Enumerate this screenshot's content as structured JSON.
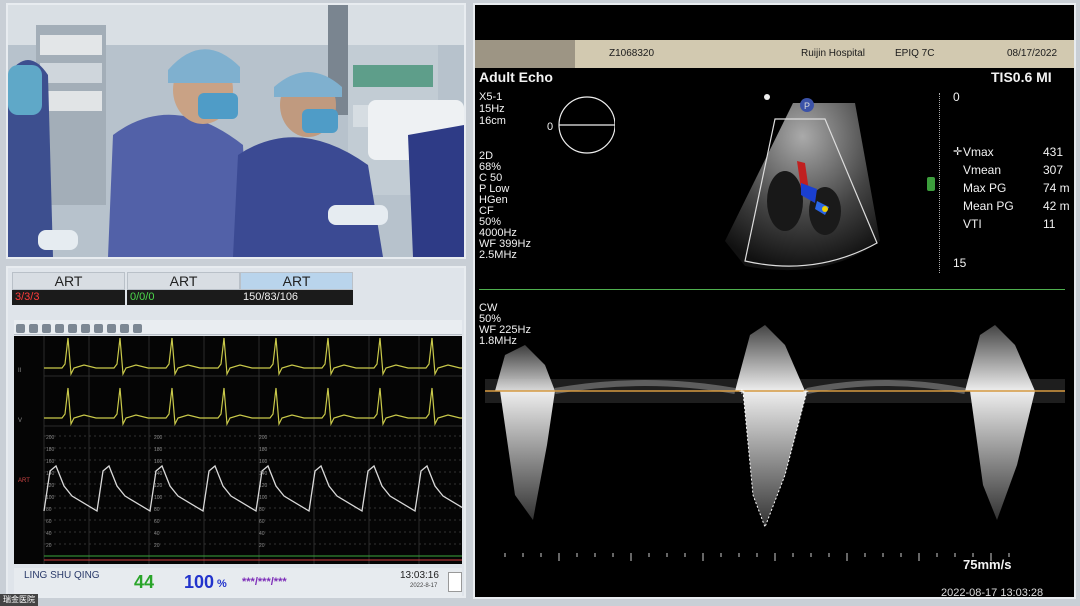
{
  "monitor": {
    "channels": [
      {
        "label": "ART",
        "value": "3/3/3",
        "color": "#ff3b3b"
      },
      {
        "label": "ART",
        "value": "0/0/0",
        "color": "#4cdc4c"
      },
      {
        "label": "ART",
        "value": "150/83/106",
        "color": "#f0f0f0"
      }
    ],
    "patient_name": "LING SHU QING",
    "heart_rate": "44",
    "spo2": "100",
    "spo2_unit": "%",
    "nibp": "***/***/***",
    "time": "13:03:16",
    "date": "2022-8-17",
    "scale_labels": [
      "200",
      "180",
      "160",
      "140",
      "120",
      "100",
      "80",
      "60",
      "40",
      "20"
    ]
  },
  "echo": {
    "patient_id": "Z1068320",
    "hospital": "Ruijin Hospital",
    "device": "EPIQ 7C",
    "date": "08/17/2022",
    "mode": "Adult Echo",
    "index": "TIS0.6 MI",
    "probe_settings": [
      "X5-1",
      "15Hz",
      "16cm"
    ],
    "image_settings": [
      "2D",
      "68%",
      "C 50",
      "P Low",
      "HGen"
    ],
    "color_settings": [
      "CF",
      "50%",
      "4000Hz",
      "WF 399Hz",
      "2.5MHz"
    ],
    "cw_settings": [
      "CW",
      "50%",
      "WF 225Hz",
      "1.8MHz"
    ],
    "depth_start": "0",
    "depth_end": "15",
    "doppler_start": "0",
    "measurements": [
      {
        "label": "Vmax",
        "value": "431"
      },
      {
        "label": "Vmean",
        "value": "307"
      },
      {
        "label": "Max PG",
        "value": "74 m"
      },
      {
        "label": "Mean PG",
        "value": "42 m"
      },
      {
        "label": "VTI",
        "value": "11"
      }
    ],
    "sweep_speed": "75mm/s",
    "timestamp": "2022-08-17  13:03:28",
    "marker_p": "P"
  },
  "corner_label": "瑞金医院"
}
